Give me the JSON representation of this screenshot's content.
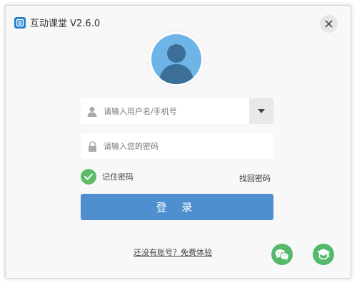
{
  "window": {
    "title": "互动课堂 V2.6.0"
  },
  "login": {
    "username_placeholder": "请输入用户名/手机号",
    "password_placeholder": "请输入您的密码",
    "remember_label": "记住密码",
    "forgot_label": "找回密码",
    "submit_label": "登 录",
    "register_link": "还没有账号？免费体验"
  },
  "icons": {
    "close": "close-icon",
    "avatar": "user-avatar-icon",
    "user": "user-icon",
    "lock": "lock-icon",
    "dropdown": "caret-down-icon",
    "check": "check-icon",
    "wechat": "wechat-icon",
    "other": "mortarboard-icon"
  },
  "colors": {
    "accent": "#4f8fcf",
    "green": "#55b86a",
    "avatar_bg": "#6fb4e6"
  }
}
